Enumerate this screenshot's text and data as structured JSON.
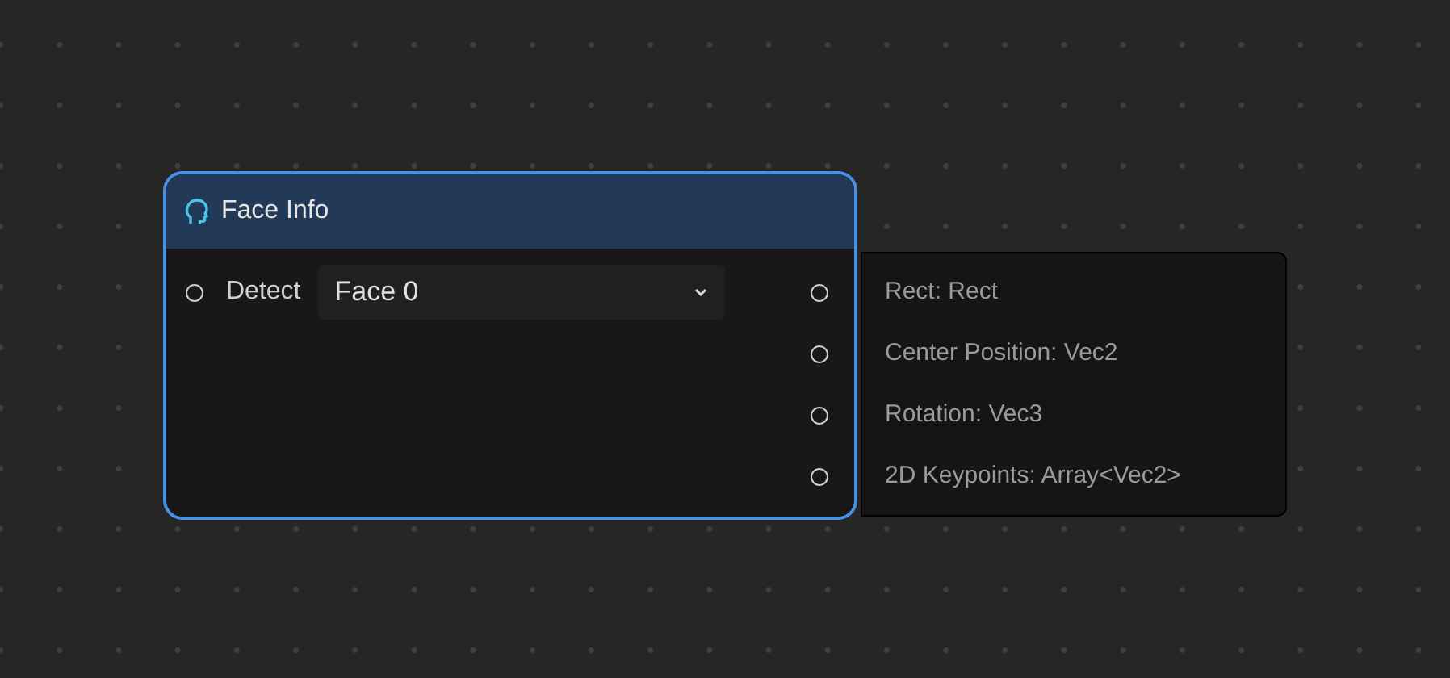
{
  "node": {
    "title": "Face Info",
    "selected": true,
    "inputs": [
      {
        "label": "Detect",
        "value": "Face 0"
      }
    ],
    "outputs": [
      {
        "label": "Rect: Rect"
      },
      {
        "label": "Center Position: Vec2"
      },
      {
        "label": "Rotation: Vec3"
      },
      {
        "label": "2D Keypoints: Array<Vec2>"
      }
    ]
  }
}
